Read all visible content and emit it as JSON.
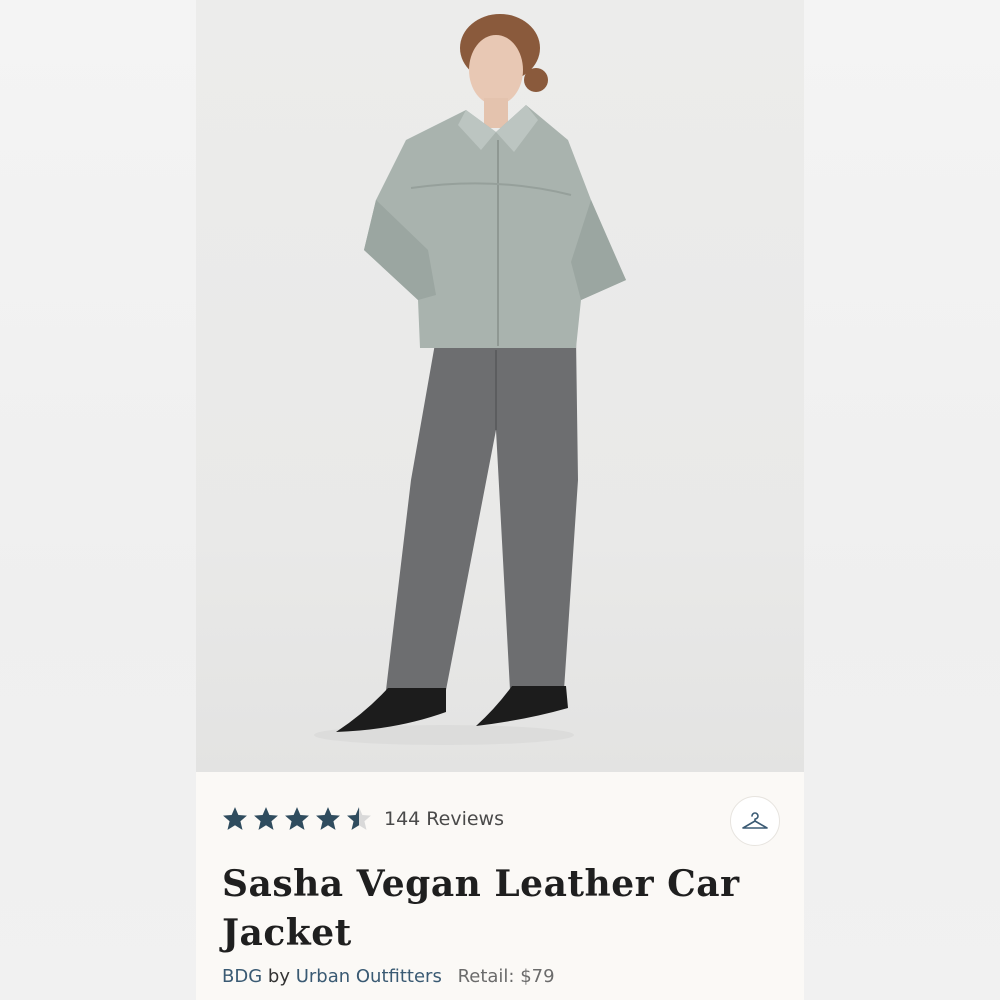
{
  "listing": {
    "rating": 4.5,
    "rating_max": 5,
    "review_count_text": "144 Reviews",
    "title": "Sasha Vegan Leather Car Jacket",
    "brand": "BDG",
    "by_text": "by",
    "seller": "Urban Outfitters",
    "retail_text": "Retail: $79",
    "actions": {
      "hanger_icon": "hanger-icon"
    }
  },
  "colors": {
    "star_fill": "#2f4c5e",
    "star_empty": "#d9d9d9",
    "link": "#3a5a73",
    "card_bg": "#fbf9f6"
  }
}
